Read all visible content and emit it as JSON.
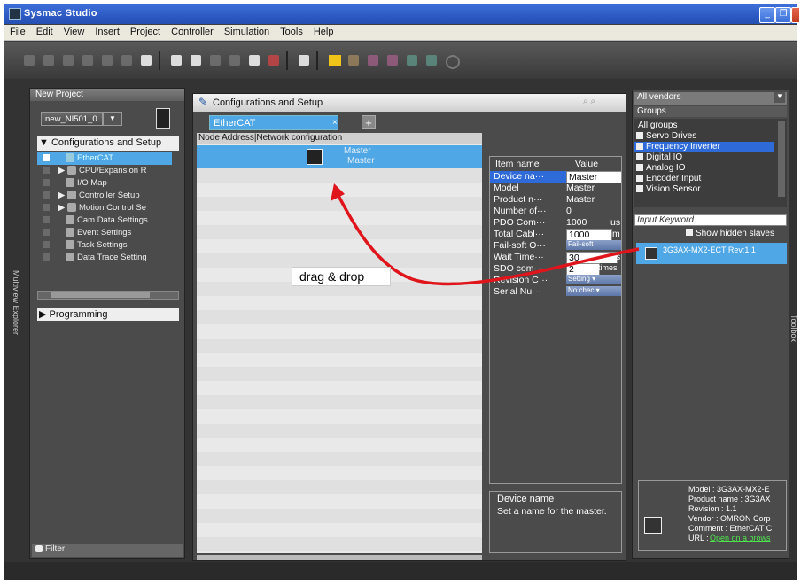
{
  "window": {
    "title": "Sysmac Studio",
    "controls": [
      "minimize",
      "maximize",
      "close"
    ]
  },
  "menu": [
    "File",
    "Edit",
    "View",
    "Insert",
    "Project",
    "Controller",
    "Simulation",
    "Tools",
    "Help"
  ],
  "explorer": {
    "header": "New Project",
    "device_selector": "new_NI501_0",
    "config_section": "Configurations and Setup",
    "items": [
      {
        "label": "EtherCAT",
        "selected": true
      },
      {
        "label": "CPU/Expansion R"
      },
      {
        "label": "I/O Map"
      },
      {
        "label": "Controller Setup"
      },
      {
        "label": "Motion Control Se"
      },
      {
        "label": "Cam Data Settings"
      },
      {
        "label": "Event Settings"
      },
      {
        "label": "Task Settings"
      },
      {
        "label": "Data Trace Setting"
      }
    ],
    "programming_section": "Programming",
    "filter_label": "Filter",
    "side_label": "Multiview Explorer"
  },
  "editor": {
    "header": "Configurations and Setup",
    "tab_label": "EtherCAT",
    "tab_close": "×",
    "add_tab": "+",
    "column_header": "Node Address|Network configuration",
    "master_label_1": "Master",
    "master_label_2": "Master"
  },
  "properties": {
    "col_item": "Item name",
    "col_value": "Value",
    "rows": [
      {
        "name": "Device na···",
        "value": "Master",
        "style": "box"
      },
      {
        "name": "Model",
        "value": "Master"
      },
      {
        "name": "Product n···",
        "value": "Master"
      },
      {
        "name": "Number of···",
        "value": "0"
      },
      {
        "name": "PDO Com···",
        "value": "1000",
        "unit": "us"
      },
      {
        "name": "Total Cabl···",
        "value": "1000",
        "unit": "m",
        "style": "box"
      },
      {
        "name": "Fail-soft O···",
        "value": "Fail-soft",
        "style": "btn"
      },
      {
        "name": "Wait Time···",
        "value": "30",
        "unit": "s",
        "style": "box"
      },
      {
        "name": "SDO com···",
        "value": "2",
        "unit": "times",
        "style": "box"
      },
      {
        "name": "Revision C···",
        "value": "Setting ▾",
        "style": "btn"
      },
      {
        "name": "Serial Nu···",
        "value": "No chec ▾",
        "style": "btn"
      }
    ],
    "help_title": "Device name",
    "help_text": "Set a name for the master."
  },
  "annotation": {
    "label": "drag & drop"
  },
  "toolbox": {
    "vendor_select": "All vendors",
    "groups_header": "Groups",
    "groups": [
      "All groups",
      "Servo Drives",
      "Frequency Inverter",
      "Digital IO",
      "Analog IO",
      "Encoder Input",
      "Vision Sensor"
    ],
    "selected_group": "Frequency Inverter",
    "keyword_placeholder": "Input Keyword",
    "show_hidden_label": "Show hidden slaves",
    "device_item": "3G3AX-MX2-ECT Rev:1.1",
    "details": [
      "Model : 3G3AX-MX2-E",
      "Product name : 3G3AX",
      "Revision : 1.1",
      "Vendor : OMRON Corp",
      "Comment : EtherCAT C",
      "URL : "
    ],
    "url_link": "Open on a brows",
    "side_label": "Toolbox"
  },
  "colors": {
    "accent_blue": "#4fa7e6",
    "selection_blue": "#2f6bd8",
    "arrow_red": "#e0151c"
  }
}
